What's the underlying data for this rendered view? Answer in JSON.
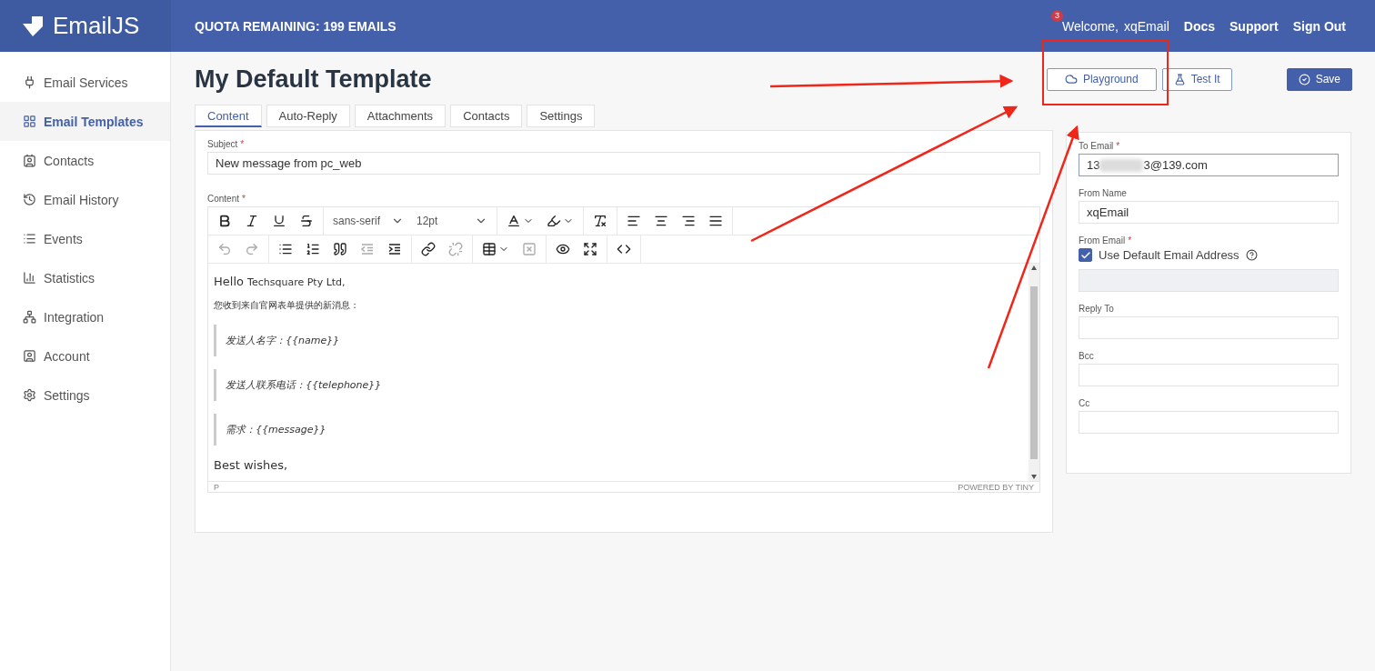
{
  "app": {
    "logo": "EmailJS",
    "quota": "QUOTA REMAINING: 199 EMAILS",
    "notification_count": "3",
    "welcome": "Welcome,",
    "user": "xqEmail",
    "nav_links": [
      "Docs",
      "Support",
      "Sign Out"
    ]
  },
  "sidebar": {
    "items": [
      {
        "label": "Email Services",
        "kind": "plug",
        "selected": false
      },
      {
        "label": "Email Templates",
        "kind": "templates",
        "selected": true
      },
      {
        "label": "Contacts",
        "kind": "contacts",
        "selected": false
      },
      {
        "label": "Email History",
        "kind": "history",
        "selected": false
      },
      {
        "label": "Events",
        "kind": "events",
        "selected": false
      },
      {
        "label": "Statistics",
        "kind": "statistics",
        "selected": false
      },
      {
        "label": "Integration",
        "kind": "integration",
        "selected": false
      },
      {
        "label": "Account",
        "kind": "account",
        "selected": false
      },
      {
        "label": "Settings",
        "kind": "settings",
        "selected": false
      }
    ]
  },
  "page": {
    "title": "My Default Template",
    "actions": [
      {
        "label": "Playground",
        "kind": "playground"
      },
      {
        "label": "Test It",
        "kind": "test"
      },
      {
        "label": "Save",
        "kind": "save"
      }
    ]
  },
  "tabs": [
    {
      "label": "Content",
      "selected": true
    },
    {
      "label": "Auto-Reply",
      "selected": false
    },
    {
      "label": "Attachments",
      "selected": false
    },
    {
      "label": "Contacts",
      "selected": false
    },
    {
      "label": "Settings",
      "selected": false
    }
  ],
  "subject": {
    "label": "Subject",
    "required_mark": "*",
    "value": "New message from pc_web"
  },
  "content": {
    "label": "Content",
    "required_mark": "*",
    "toolbar": [
      [
        [
          {
            "kind": "bold",
            "disabled": false
          },
          {
            "kind": "italic",
            "disabled": false
          },
          {
            "kind": "underline",
            "disabled": false
          },
          {
            "kind": "strikethrough",
            "disabled": false
          }
        ],
        [
          {
            "kind": "select",
            "value": "sans-serif",
            "disabled": false
          },
          {
            "kind": "select",
            "value": "12pt",
            "disabled": false
          }
        ],
        [
          {
            "kind": "text-color",
            "disabled": false
          },
          {
            "kind": "highlight",
            "disabled": false
          }
        ],
        [
          {
            "kind": "clear-format",
            "disabled": false
          }
        ],
        [
          {
            "kind": "align-left",
            "disabled": false
          },
          {
            "kind": "align-center",
            "disabled": false
          },
          {
            "kind": "align-right",
            "disabled": false
          },
          {
            "kind": "align-justify",
            "disabled": false
          }
        ]
      ],
      [
        [
          {
            "kind": "undo",
            "disabled": true
          },
          {
            "kind": "redo",
            "disabled": true
          }
        ],
        [
          {
            "kind": "bullet-list",
            "disabled": false
          },
          {
            "kind": "numbered-list",
            "disabled": false
          },
          {
            "kind": "quote",
            "disabled": false
          },
          {
            "kind": "outdent",
            "disabled": true
          },
          {
            "kind": "indent",
            "disabled": false
          }
        ],
        [
          {
            "kind": "link",
            "disabled": false
          },
          {
            "kind": "unlink",
            "disabled": true
          }
        ],
        [
          {
            "kind": "table",
            "disabled": false
          },
          {
            "kind": "delete-table",
            "disabled": true
          }
        ],
        [
          {
            "kind": "preview",
            "disabled": false
          },
          {
            "kind": "fullscreen",
            "disabled": false
          }
        ],
        [
          {
            "kind": "code",
            "disabled": false
          }
        ]
      ]
    ],
    "body": [
      {
        "kind": "greeting",
        "text": "Hello",
        "rest": "Techsquare Pty Ltd,"
      },
      {
        "kind": "paragraph",
        "text": "您收到来自官网表单提供的新消息："
      },
      {
        "kind": "quote",
        "text": "发送人名字：{{name}}"
      },
      {
        "kind": "quote",
        "text": "发送人联系电话：{{telephone}}"
      },
      {
        "kind": "quote",
        "text": "需求：{{message}}"
      },
      {
        "kind": "closing",
        "text": "Best wishes,"
      }
    ],
    "status_path": "P",
    "powered_by": "POWERED BY TINY"
  },
  "side_form": {
    "to_email": {
      "label": "To Email",
      "required_mark": "*",
      "value_start": "13",
      "value_end": "3@139.com",
      "focused": true
    },
    "from_name": {
      "label": "From Name",
      "value": "xqEmail"
    },
    "from_email": {
      "label": "From Email",
      "required_mark": "*",
      "checkbox_label": "Use Default Email Address",
      "checked": true,
      "disabled_field": true
    },
    "fields": [
      {
        "label": "Reply To"
      },
      {
        "label": "Bcc"
      },
      {
        "label": "Cc"
      }
    ]
  }
}
